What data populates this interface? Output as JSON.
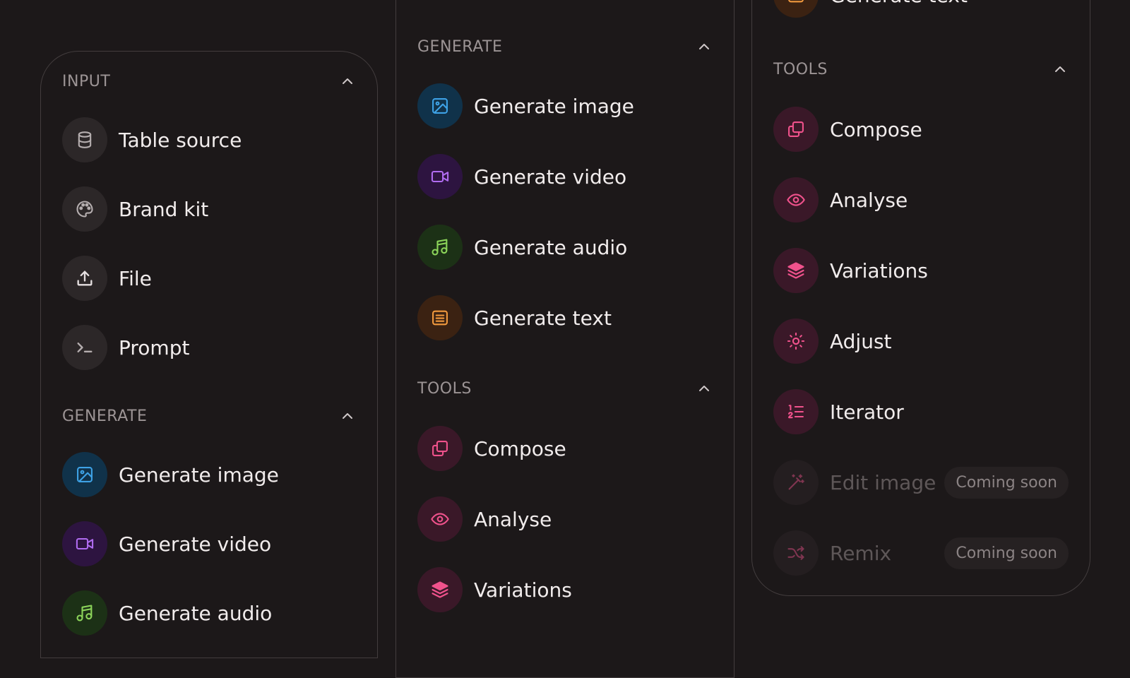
{
  "colors": {
    "background": "#1c1819",
    "section_title": "#9c9495",
    "label": "#f1ecec",
    "gray": "#b5aeaf",
    "blue": "#3ea2e6",
    "purple": "#b06cf0",
    "green": "#8cd45a",
    "orange": "#f29a3e",
    "pink": "#f0528c"
  },
  "panel1": {
    "input": {
      "title": "INPUT",
      "items": [
        {
          "label": "Table source",
          "icon": "database-icon"
        },
        {
          "label": "Brand kit",
          "icon": "palette-icon"
        },
        {
          "label": "File",
          "icon": "upload-icon"
        },
        {
          "label": "Prompt",
          "icon": "terminal-icon"
        }
      ]
    },
    "generate": {
      "title": "GENERATE",
      "items": [
        {
          "label": "Generate image",
          "icon": "image-icon"
        },
        {
          "label": "Generate video",
          "icon": "video-icon"
        },
        {
          "label": "Generate audio",
          "icon": "music-icon"
        }
      ]
    }
  },
  "panel2": {
    "generate": {
      "title": "GENERATE",
      "items": [
        {
          "label": "Generate image",
          "icon": "image-icon"
        },
        {
          "label": "Generate video",
          "icon": "video-icon"
        },
        {
          "label": "Generate audio",
          "icon": "music-icon"
        },
        {
          "label": "Generate text",
          "icon": "text-icon"
        }
      ]
    },
    "tools": {
      "title": "TOOLS",
      "items": [
        {
          "label": "Compose",
          "icon": "copy-icon"
        },
        {
          "label": "Analyse",
          "icon": "eye-icon"
        },
        {
          "label": "Variations",
          "icon": "layers-icon"
        }
      ]
    }
  },
  "panel3": {
    "top_item": {
      "label": "Generate text",
      "icon": "text-icon"
    },
    "tools": {
      "title": "TOOLS",
      "items": [
        {
          "label": "Compose",
          "icon": "copy-icon"
        },
        {
          "label": "Analyse",
          "icon": "eye-icon"
        },
        {
          "label": "Variations",
          "icon": "layers-icon"
        },
        {
          "label": "Adjust",
          "icon": "sun-icon"
        },
        {
          "label": "Iterator",
          "icon": "list-ordered-icon"
        },
        {
          "label": "Edit image",
          "icon": "magic-wand-icon",
          "badge": "Coming soon"
        },
        {
          "label": "Remix",
          "icon": "shuffle-icon",
          "badge": "Coming soon"
        }
      ]
    }
  }
}
